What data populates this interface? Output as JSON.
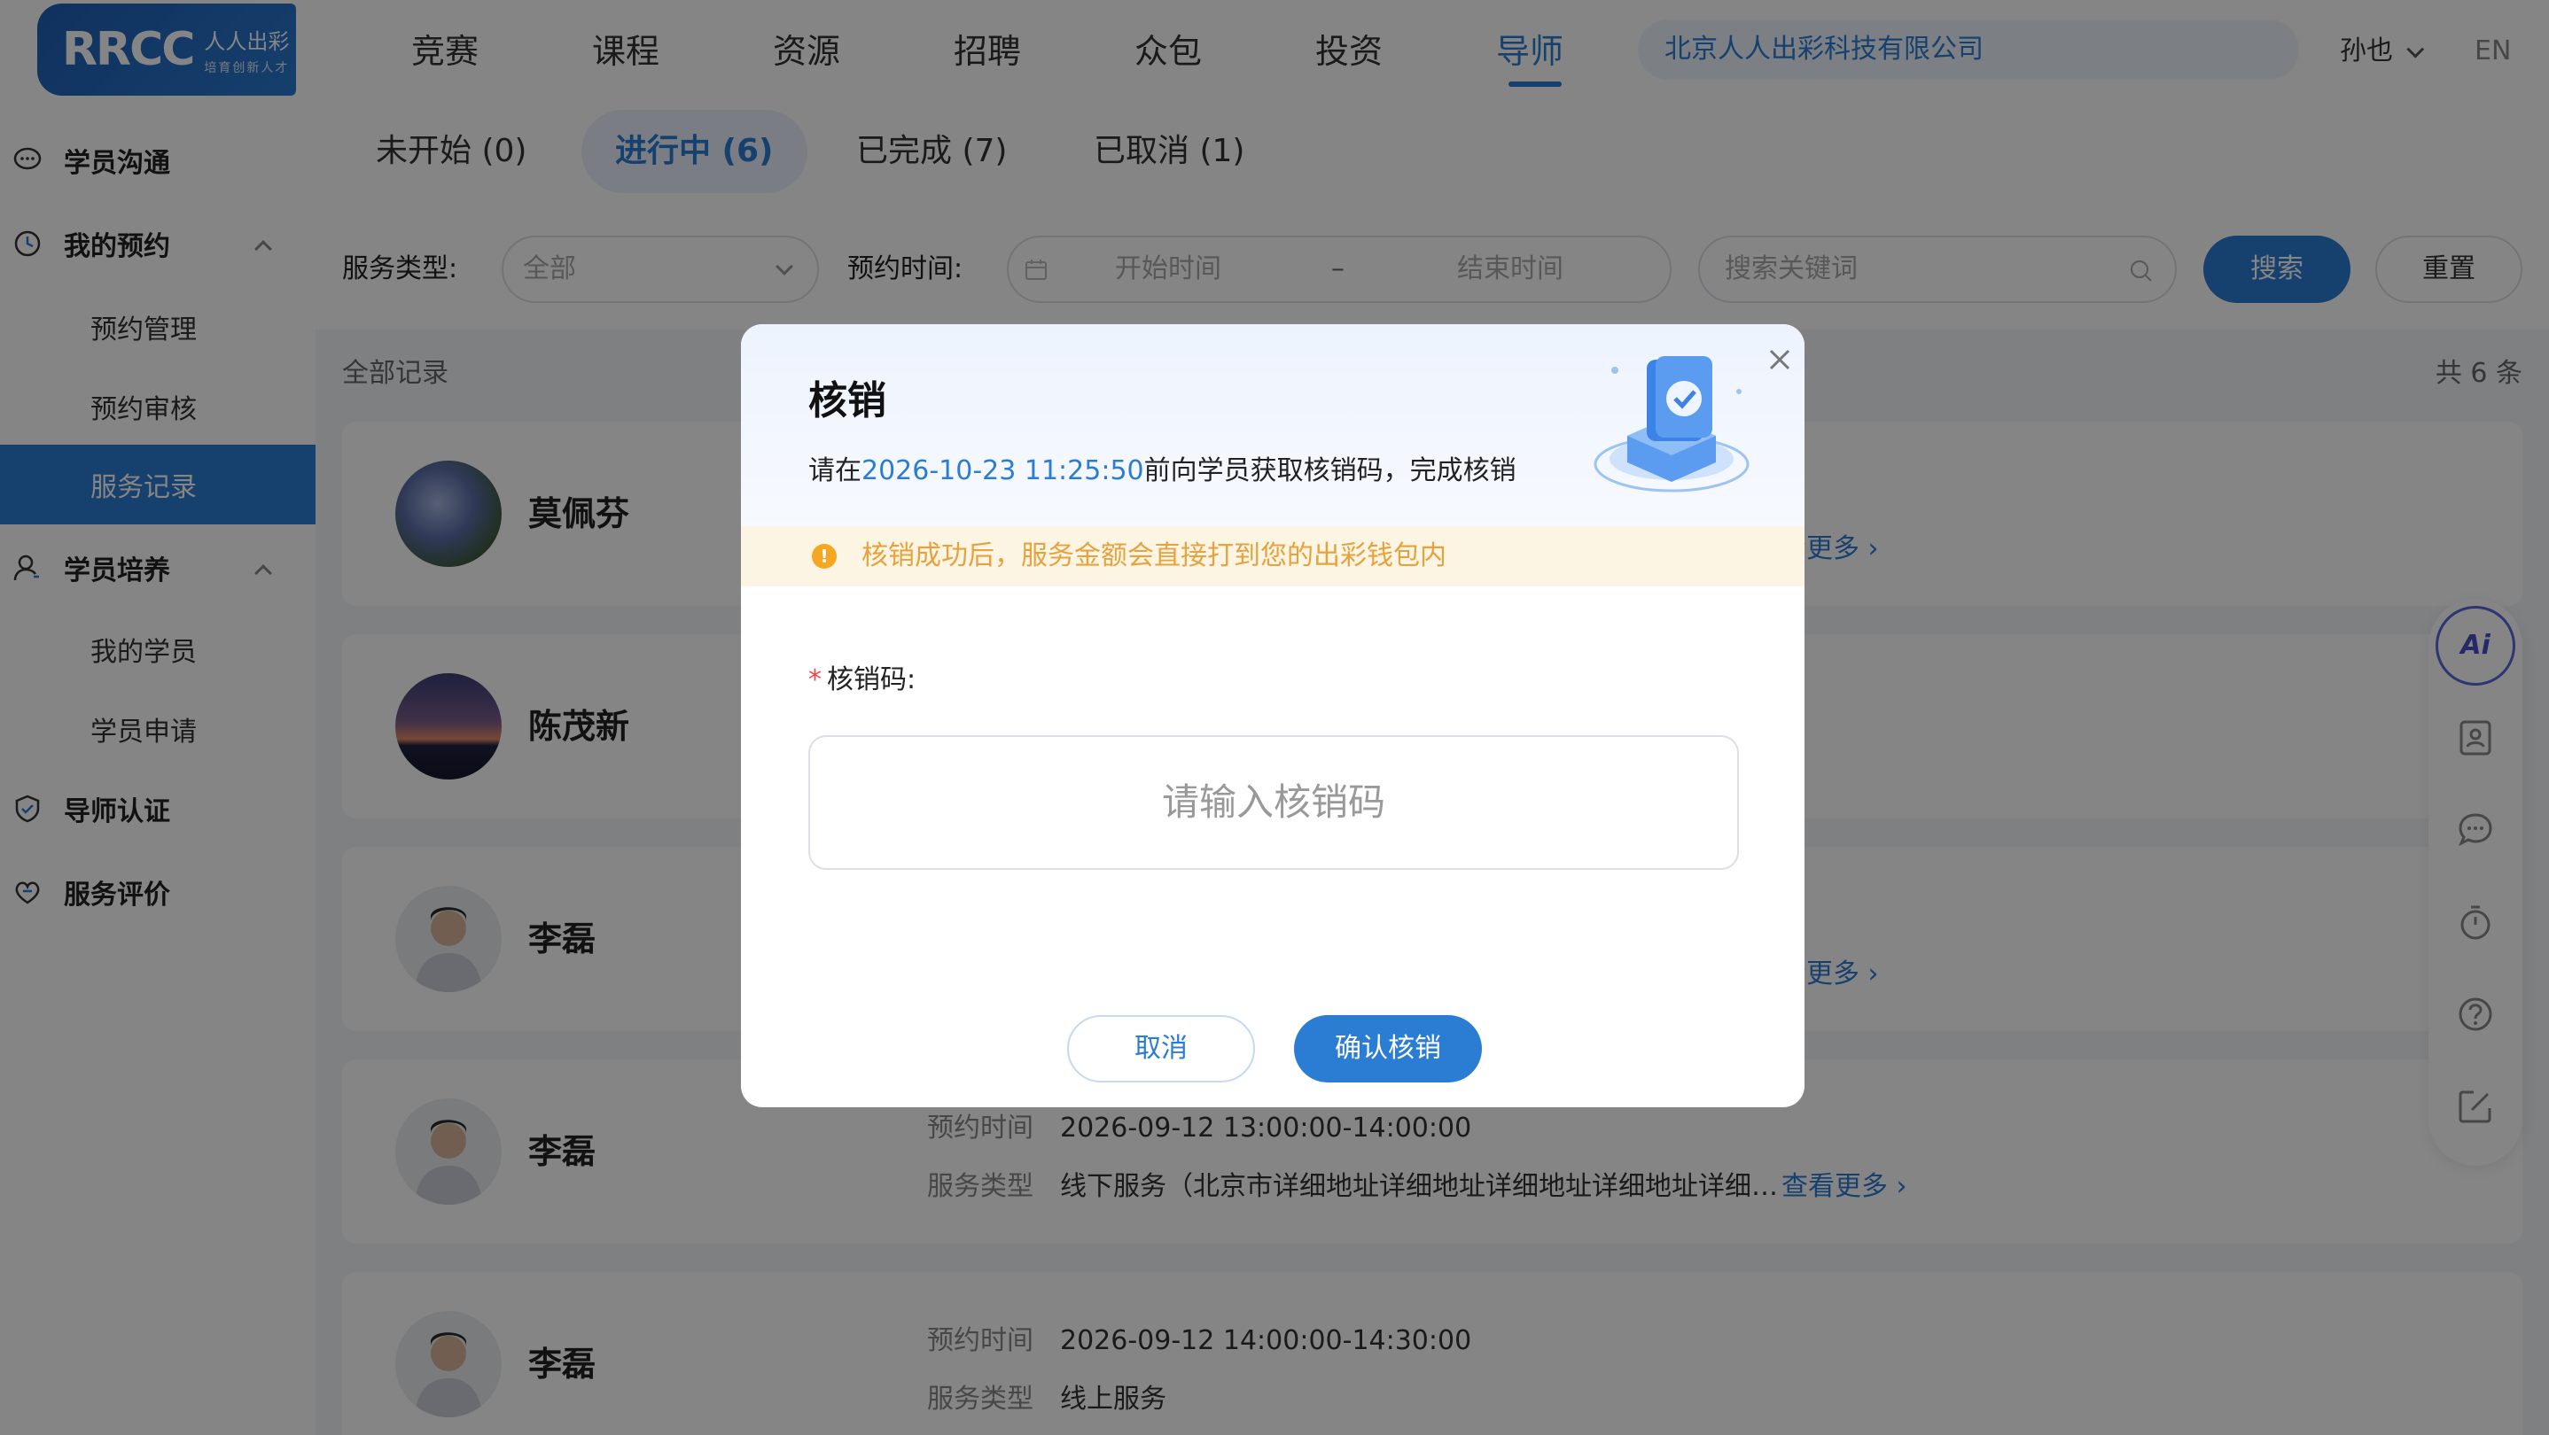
{
  "header": {
    "logo_mark": "RRCC",
    "logo_sub1": "人人出彩",
    "logo_sub2": "培育创新人才",
    "nav": [
      "竞赛",
      "课程",
      "资源",
      "招聘",
      "众包",
      "投资",
      "导师"
    ],
    "active_nav": "导师",
    "company": "北京人人出彩科技有限公司",
    "user": "孙也",
    "lang": "EN"
  },
  "sidebar": {
    "groups": [
      {
        "label": "学员沟通"
      },
      {
        "label": "我的预约",
        "children": [
          "预约管理",
          "预约审核",
          "服务记录"
        ]
      },
      {
        "label": "学员培养",
        "children": [
          "我的学员",
          "学员申请"
        ]
      },
      {
        "label": "导师认证"
      },
      {
        "label": "服务评价"
      }
    ],
    "active": "服务记录"
  },
  "tabs": [
    "未开始 (0)",
    "进行中 (6)",
    "已完成 (7)",
    "已取消 (1)"
  ],
  "filter": {
    "service_type_label": "服务类型:",
    "service_type_value": "全部",
    "time_label": "预约时间:",
    "start_placeholder": "开始时间",
    "sep": "–",
    "end_placeholder": "结束时间",
    "keyword_placeholder": "搜索关键词",
    "search_btn": "搜索",
    "reset_btn": "重置"
  },
  "list": {
    "title": "全部记录",
    "total": "共 6 条",
    "time_key": "预约时间",
    "type_key": "服务类型",
    "more": "查看更多",
    "more_partial": "看更多",
    "cards": [
      {
        "name": "莫佩芬"
      },
      {
        "name": "陈茂新"
      },
      {
        "name": "李磊"
      },
      {
        "name": "李磊",
        "time": "2026-09-12 13:00:00-14:00:00",
        "type": "线下服务（北京市详细地址详细地址详细地址详细地址详细…"
      },
      {
        "name": "李磊",
        "time": "2026-09-12 14:00:00-14:30:00",
        "type": "线上服务"
      }
    ]
  },
  "rtool": {
    "ai": "Ai"
  },
  "modal": {
    "title": "核销",
    "desc_prefix": "请在",
    "desc_time": "2026-10-23 11:25:50",
    "desc_suffix": "前向学员获取核销码，完成核销",
    "notice": "核销成功后，服务金额会直接打到您的出彩钱包内",
    "field_label": "核销码:",
    "required_mark": "*",
    "input_placeholder": "请输入核销码",
    "cancel": "取消",
    "confirm": "确认核销"
  },
  "colors": {
    "accent": "#2b7cd3",
    "warning": "#e6a23c",
    "required": "#e5484d"
  }
}
